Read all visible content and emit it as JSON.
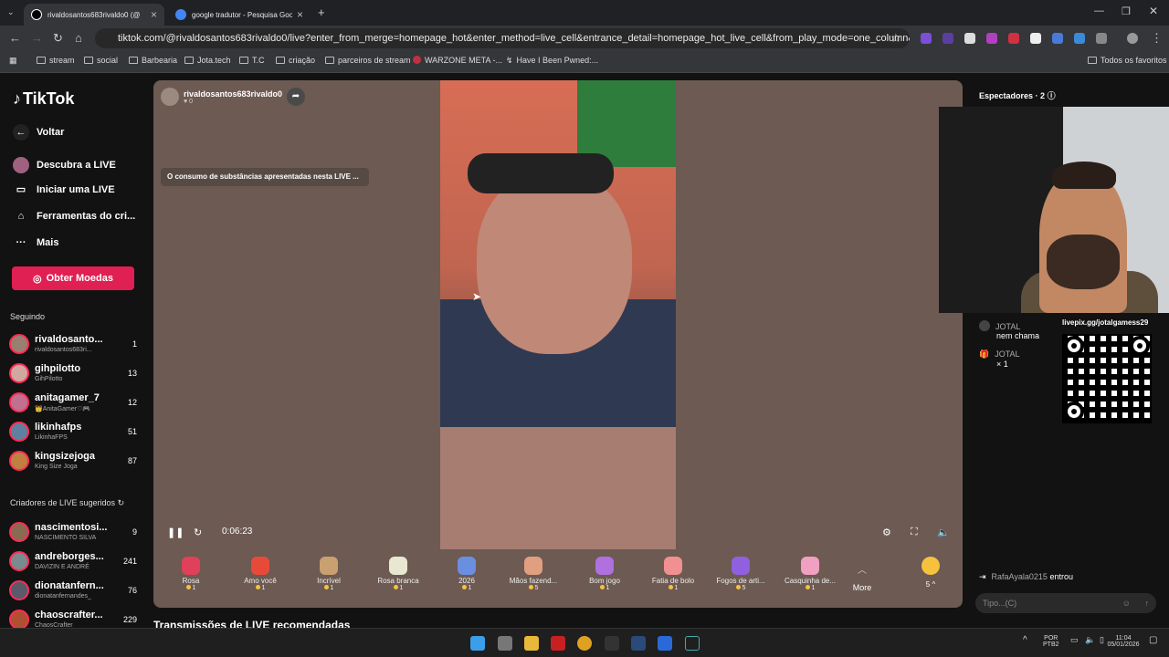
{
  "browser": {
    "tabs": [
      {
        "label": "rivaldosantos683rivaldo0 (@",
        "active": true
      },
      {
        "label": "google tradutor - Pesquisa Goo",
        "active": false
      }
    ],
    "url": "tiktok.com/@rivaldosantos683rivaldo0/live?enter_from_merge=homepage_hot&enter_method=live_cell&entrance_detail=homepage_hot_live_cell&from_play_mode=one_column&is_guest_connect=0&...",
    "bookmarks": [
      "stream",
      "social",
      "Barbearia",
      "Jota.tech",
      "T.C",
      "criação",
      "parceiros de stream",
      "WARZONE META -...",
      "Have I Been Pwned:..."
    ],
    "all_bookmarks": "Todos os favoritos"
  },
  "sidebar": {
    "brand": "TikTok",
    "nav": [
      {
        "label": "Voltar",
        "icon": "back-arrow-icon"
      },
      {
        "label": "Descubra a LIVE",
        "icon": "live-icon"
      },
      {
        "label": "Iniciar uma LIVE",
        "icon": "camera-icon"
      },
      {
        "label": "Ferramentas do cri...",
        "icon": "home-icon"
      },
      {
        "label": "Mais",
        "icon": "more-icon"
      }
    ],
    "coins_button": "Obter Moedas",
    "following_title": "Seguindo",
    "following": [
      {
        "name": "rivaldosanto...",
        "sub": "rivaldosantos683ri...",
        "count": "1"
      },
      {
        "name": "gihpilotto",
        "sub": "GihPilotto",
        "count": "13"
      },
      {
        "name": "anitagamer_7",
        "sub": "👑AnitaGamer♡🎮",
        "count": "12"
      },
      {
        "name": "likinhafps",
        "sub": "LikinhaFPS",
        "count": "51"
      },
      {
        "name": "kingsizejoga",
        "sub": "King Size Joga",
        "count": "87"
      }
    ],
    "suggested_title": "Criadores de LIVE sugeridos",
    "suggested": [
      {
        "name": "nascimentosi...",
        "sub": "NASCIMENTO SILVA",
        "count": "9"
      },
      {
        "name": "andreborges...",
        "sub": "DAVIZIN E ANDRÉ",
        "count": "241"
      },
      {
        "name": "dionatanfern...",
        "sub": "dionatanfernandes_",
        "count": "76"
      },
      {
        "name": "chaoscrafter...",
        "sub": "ChaosCrafter",
        "count": "229"
      }
    ]
  },
  "player": {
    "streamer": "rivaldosantos683rivaldo0",
    "likes": "0",
    "warning": "O consumo de substâncias apresentadas nesta LIVE ...",
    "time": "0:06:23"
  },
  "gifts": [
    {
      "name": "Rosa",
      "price": "1",
      "color": "#e0405a"
    },
    {
      "name": "Amo você",
      "price": "1",
      "color": "#e84a3a"
    },
    {
      "name": "Incrível",
      "price": "1",
      "color": "#c9a070"
    },
    {
      "name": "Rosa branca",
      "price": "1",
      "color": "#e8e8d0"
    },
    {
      "name": "2026",
      "price": "1",
      "color": "#6b8fe0"
    },
    {
      "name": "Mãos fazend...",
      "price": "5",
      "color": "#e0a080"
    },
    {
      "name": "Bom jogo",
      "price": "1",
      "color": "#b070e0"
    },
    {
      "name": "Fatia de bolo",
      "price": "1",
      "color": "#f09090"
    },
    {
      "name": "Fogos de arti...",
      "price": "5",
      "color": "#9060e0"
    },
    {
      "name": "Casquinha de...",
      "price": "1",
      "color": "#f0a0c0"
    }
  ],
  "gift_more": "More",
  "coin_balance": "5",
  "viewers": {
    "label": "Espectadores",
    "count": "2"
  },
  "chat": {
    "overlay_link": "livepix.gg/jotalgamess29",
    "messages": [
      {
        "user": "JOTAL",
        "text": "nem chama"
      },
      {
        "user": "JOTAL",
        "text": "× 1"
      }
    ],
    "joined_user": "RafaAyala0215",
    "joined_text": "entrou",
    "input_placeholder": "Tipo...(C)"
  },
  "recommended_title": "Transmissões de LIVE recomendadas",
  "taskbar": {
    "lang": "POR",
    "layout": "PTB2",
    "time": "11:04",
    "date": "05/01/2026"
  }
}
